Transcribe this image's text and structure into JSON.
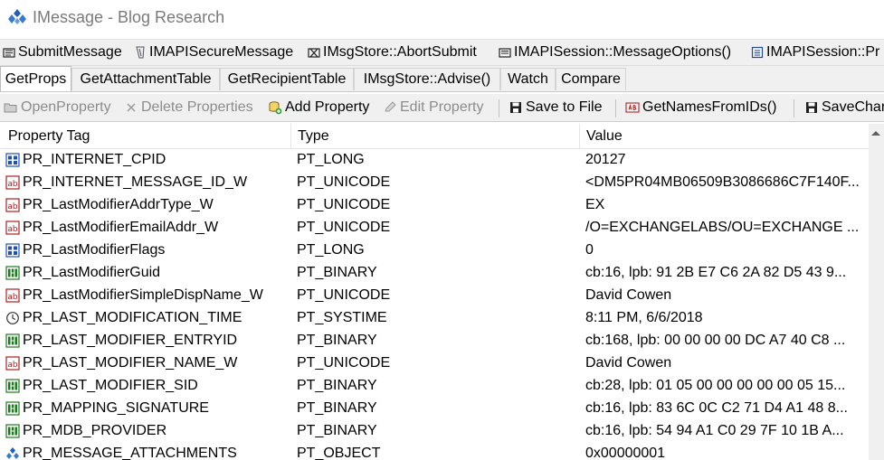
{
  "window": {
    "title": "IMessage - Blog Research"
  },
  "action_toolbar": {
    "items": [
      {
        "label": "SubmitMessage",
        "icon": "submit-message-icon"
      },
      {
        "label": "IMAPISecureMessage",
        "icon": "secure-message-icon"
      },
      {
        "label": "IMsgStore::AbortSubmit",
        "icon": "abort-submit-icon"
      },
      {
        "label": "IMAPISession::MessageOptions()",
        "icon": "message-options-icon"
      },
      {
        "label": "IMAPISession::Pr",
        "icon": "session-icon"
      }
    ]
  },
  "tabs": [
    {
      "label": "GetProps",
      "active": true
    },
    {
      "label": "GetAttachmentTable"
    },
    {
      "label": "GetRecipientTable"
    },
    {
      "label": "IMsgStore::Advise()"
    },
    {
      "label": "Watch"
    },
    {
      "label": "Compare"
    }
  ],
  "toolbar": {
    "open_property": "OpenProperty",
    "delete_properties": "Delete Properties",
    "add_property": "Add Property",
    "edit_property": "Edit Property",
    "save_to_file": "Save to File",
    "get_names_from_ids": "GetNamesFromIDs()",
    "save_changes": "SaveChar"
  },
  "grid": {
    "columns": [
      "Property Tag",
      "Type",
      "Value"
    ],
    "rows": [
      {
        "tag": "PR_INTERNET_CPID",
        "type": "PT_LONG",
        "value": "20127",
        "icon": "long-type-icon"
      },
      {
        "tag": "PR_INTERNET_MESSAGE_ID_W",
        "type": "PT_UNICODE",
        "value": "<DM5PR04MB06509B3086686C7F140F...",
        "icon": "string-type-icon"
      },
      {
        "tag": "PR_LastModifierAddrType_W",
        "type": "PT_UNICODE",
        "value": "EX",
        "icon": "string-type-icon"
      },
      {
        "tag": "PR_LastModifierEmailAddr_W",
        "type": "PT_UNICODE",
        "value": "/O=EXCHANGELABS/OU=EXCHANGE ...",
        "icon": "string-type-icon"
      },
      {
        "tag": "PR_LastModifierFlags",
        "type": "PT_LONG",
        "value": "0",
        "icon": "long-type-icon"
      },
      {
        "tag": "PR_LastModifierGuid",
        "type": "PT_BINARY",
        "value": "cb:16, lpb: 91 2B E7 C6 2A 82 D5 43 9...",
        "icon": "binary-type-icon"
      },
      {
        "tag": "PR_LastModifierSimpleDispName_W",
        "type": "PT_UNICODE",
        "value": "David Cowen",
        "icon": "string-type-icon"
      },
      {
        "tag": "PR_LAST_MODIFICATION_TIME",
        "type": "PT_SYSTIME",
        "value": "8:11 PM, 6/6/2018",
        "icon": "clock-icon"
      },
      {
        "tag": "PR_LAST_MODIFIER_ENTRYID",
        "type": "PT_BINARY",
        "value": "cb:168, lpb: 00 00 00 00 DC A7 40 C8 ...",
        "icon": "binary-type-icon"
      },
      {
        "tag": "PR_LAST_MODIFIER_NAME_W",
        "type": "PT_UNICODE",
        "value": "David Cowen",
        "icon": "string-type-icon"
      },
      {
        "tag": "PR_LAST_MODIFIER_SID",
        "type": "PT_BINARY",
        "value": "cb:28, lpb: 01 05 00 00 00 00 00 05 15...",
        "icon": "binary-type-icon"
      },
      {
        "tag": "PR_MAPPING_SIGNATURE",
        "type": "PT_BINARY",
        "value": "cb:16, lpb: 83 6C 0C C2 71 D4 A1 48 8...",
        "icon": "binary-type-icon"
      },
      {
        "tag": "PR_MDB_PROVIDER",
        "type": "PT_BINARY",
        "value": "cb:16, lpb: 54 94 A1 C0 29 7F 10 1B A...",
        "icon": "binary-type-icon"
      },
      {
        "tag": "PR_MESSAGE_ATTACHMENTS",
        "type": "PT_OBJECT",
        "value": "0x00000001",
        "icon": "object-type-icon"
      }
    ]
  },
  "colors": {
    "chrome": "#f0f0f0",
    "disabled_text": "#8c8c8c",
    "title_text": "#7a7a7a",
    "accent": "#1f5fbf"
  }
}
